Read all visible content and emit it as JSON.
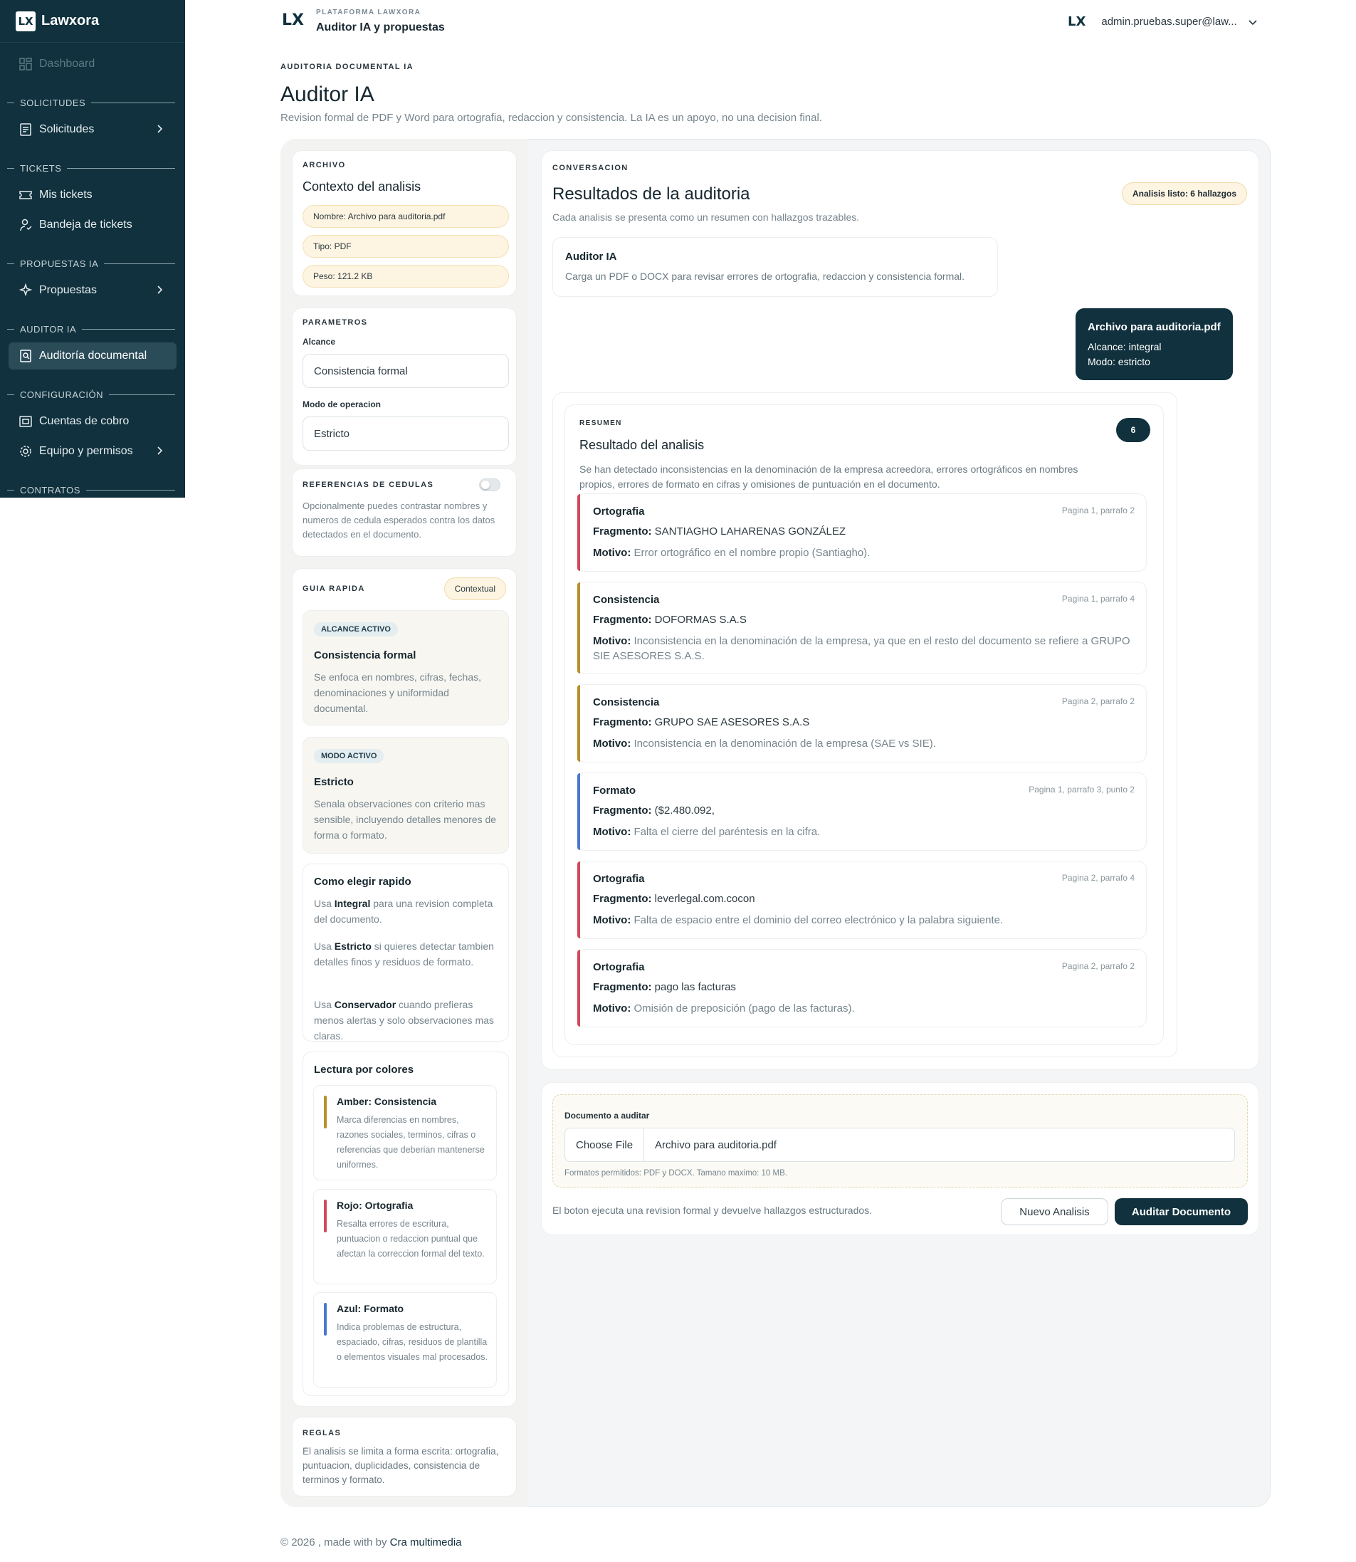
{
  "sidebar": {
    "brand": "Lawxora",
    "dashboard": "Dashboard",
    "sections": {
      "solicitudes": "SOLICITUDES",
      "tickets": "TICKETS",
      "propuestas": "PROPUESTAS IA",
      "auditor": "AUDITOR IA",
      "configuracion": "CONFIGURACIÓN",
      "contratos": "CONTRATOS"
    },
    "items": {
      "solicitudes": "Solicitudes",
      "mis_tickets": "Mis tickets",
      "bandeja": "Bandeja de tickets",
      "propuestas": "Propuestas",
      "auditoria": "Auditoría documental",
      "cuentas": "Cuentas de cobro",
      "equipo": "Equipo y permisos"
    }
  },
  "header": {
    "kicker": "PLATAFORMA LAWXORA",
    "title": "Auditor IA y propuestas",
    "user": "admin.pruebas.super@law..."
  },
  "page": {
    "kicker": "AUDITORIA DOCUMENTAL IA",
    "title": "Auditor IA",
    "description": "Revision formal de PDF y Word para ortografia, redaccion y consistencia. La IA es un apoyo, no una decision final."
  },
  "archivo": {
    "kicker": "ARCHIVO",
    "title": "Contexto del analisis",
    "nombre": "Nombre:  Archivo para auditoria.pdf",
    "tipo": "Tipo:  PDF",
    "peso": "Peso:  121.2 KB"
  },
  "parametros": {
    "kicker": "PARAMETROS",
    "alcance_label": "Alcance",
    "alcance_value": "Consistencia formal",
    "modo_label": "Modo de operacion",
    "modo_value": "Estricto"
  },
  "referencias": {
    "kicker": "REFERENCIAS DE CEDULAS",
    "toggle_on": false,
    "text": "Opcionalmente puedes contrastar nombres y numeros de cedula esperados contra los datos detectados en el documento."
  },
  "guia": {
    "kicker": "GUIA RAPIDA",
    "badge": "Contextual",
    "alcance_badge": "ALCANCE ACTIVO",
    "alcance_title": "Consistencia formal",
    "alcance_text": "Se enfoca en nombres, cifras, fechas, denominaciones y uniformidad documental.",
    "modo_badge": "MODO ACTIVO",
    "modo_title": "Estricto",
    "modo_text": "Senala observaciones con criterio mas sensible, incluyendo detalles menores de forma o formato.",
    "elegir_title": "Como elegir rapido",
    "elegir": [
      {
        "pre": "Usa ",
        "bold": "Integral",
        "post": " para una revision completa del documento."
      },
      {
        "pre": "Usa ",
        "bold": "Estricto",
        "post": " si quieres detectar tambien detalles finos y residuos de formato."
      },
      {
        "pre": "Usa ",
        "bold": "Conservador",
        "post": " cuando prefieras menos alertas y solo observaciones mas claras."
      }
    ],
    "colores_title": "Lectura por colores",
    "colores": [
      {
        "title": "Amber: Consistencia",
        "text": "Marca diferencias en nombres, razones sociales, terminos, cifras o referencias que deberian mantenerse uniformes.",
        "color": "#b8902a"
      },
      {
        "title": "Rojo: Ortografia",
        "text": "Resalta errores de escritura, puntuacion o redaccion puntual que afectan la correccion formal del texto.",
        "color": "#d04a5a"
      },
      {
        "title": "Azul: Formato",
        "text": "Indica problemas de estructura, espaciado, cifras, residuos de plantilla o elementos visuales mal procesados.",
        "color": "#4a78d0"
      }
    ]
  },
  "reglas": {
    "kicker": "REGLAS",
    "text": "El analisis se limita a forma escrita: ortografia, puntuacion, duplicidades, consistencia de terminos y formato."
  },
  "conversacion": {
    "kicker": "CONVERSACION",
    "title": "Resultados de la auditoria",
    "subtitle": "Cada analisis se presenta como un resumen con hallazgos trazables.",
    "status": "Analisis listo: 6 hallazgos",
    "bot_name": "Auditor IA",
    "bot_text": "Carga un PDF o DOCX para revisar errores de ortografia, redaccion y consistencia formal.",
    "user_file": "Archivo para auditoria.pdf",
    "user_alcance": "Alcance: integral",
    "user_modo": "Modo: estricto"
  },
  "resumen": {
    "kicker": "RESUMEN",
    "title": "Resultado del analisis",
    "count": "6",
    "text": "Se han detectado inconsistencias en la denominación de la empresa acreedora, errores ortográficos en nombres propios, errores de formato en cifras y omisiones de puntuación en el documento."
  },
  "labels": {
    "fragmento": "Fragmento:",
    "motivo": "Motivo:"
  },
  "findings": [
    {
      "type": "Ortografia",
      "page": "Pagina 1, parrafo 2",
      "fragment": "SANTIAGHO LAHARENAS GONZÁLEZ",
      "reason": "Error ortográfico en el nombre propio (Santiagho).",
      "color": "#d04a5a"
    },
    {
      "type": "Consistencia",
      "page": "Pagina 1, parrafo 4",
      "fragment": "DOFORMAS S.A.S",
      "reason": "Inconsistencia en la denominación de la empresa, ya que en el resto del documento se refiere a GRUPO SIE ASESORES S.A.S.",
      "color": "#b8902a"
    },
    {
      "type": "Consistencia",
      "page": "Pagina 2, parrafo 2",
      "fragment": "GRUPO SAE ASESORES S.A.S",
      "reason": "Inconsistencia en la denominación de la empresa (SAE vs SIE).",
      "color": "#b8902a"
    },
    {
      "type": "Formato",
      "page": "Pagina 1, parrafo 3, punto 2",
      "fragment": "($2.480.092,",
      "reason": "Falta el cierre del paréntesis en la cifra.",
      "color": "#4a78d0"
    },
    {
      "type": "Ortografia",
      "page": "Pagina 2, parrafo 4",
      "fragment": "leverlegal.com.cocon",
      "reason": "Falta de espacio entre el dominio del correo electrónico y la palabra siguiente.",
      "color": "#d04a5a"
    },
    {
      "type": "Ortografia",
      "page": "Pagina 2, parrafo 2",
      "fragment": "pago las facturas",
      "reason": "Omisión de preposición (pago de las facturas).",
      "color": "#d04a5a"
    }
  ],
  "upload": {
    "label": "Documento a auditar",
    "choose": "Choose File",
    "filename": "Archivo para auditoria.pdf",
    "hint": "Formatos permitidos: PDF y DOCX. Tamano maximo: 10 MB.",
    "footer_text": "El boton ejecuta una revision formal y devuelve hallazgos estructurados.",
    "nuevo": "Nuevo Analisis",
    "auditar": "Auditar Documento"
  },
  "footer": {
    "text": "© 2026 , made with by ",
    "link": "Cra multimedia"
  },
  "colors": {
    "sidebar": "#10313d",
    "accent": "#10313d",
    "amber": "#b8902a",
    "red": "#d04a5a",
    "blue": "#4a78d0"
  }
}
